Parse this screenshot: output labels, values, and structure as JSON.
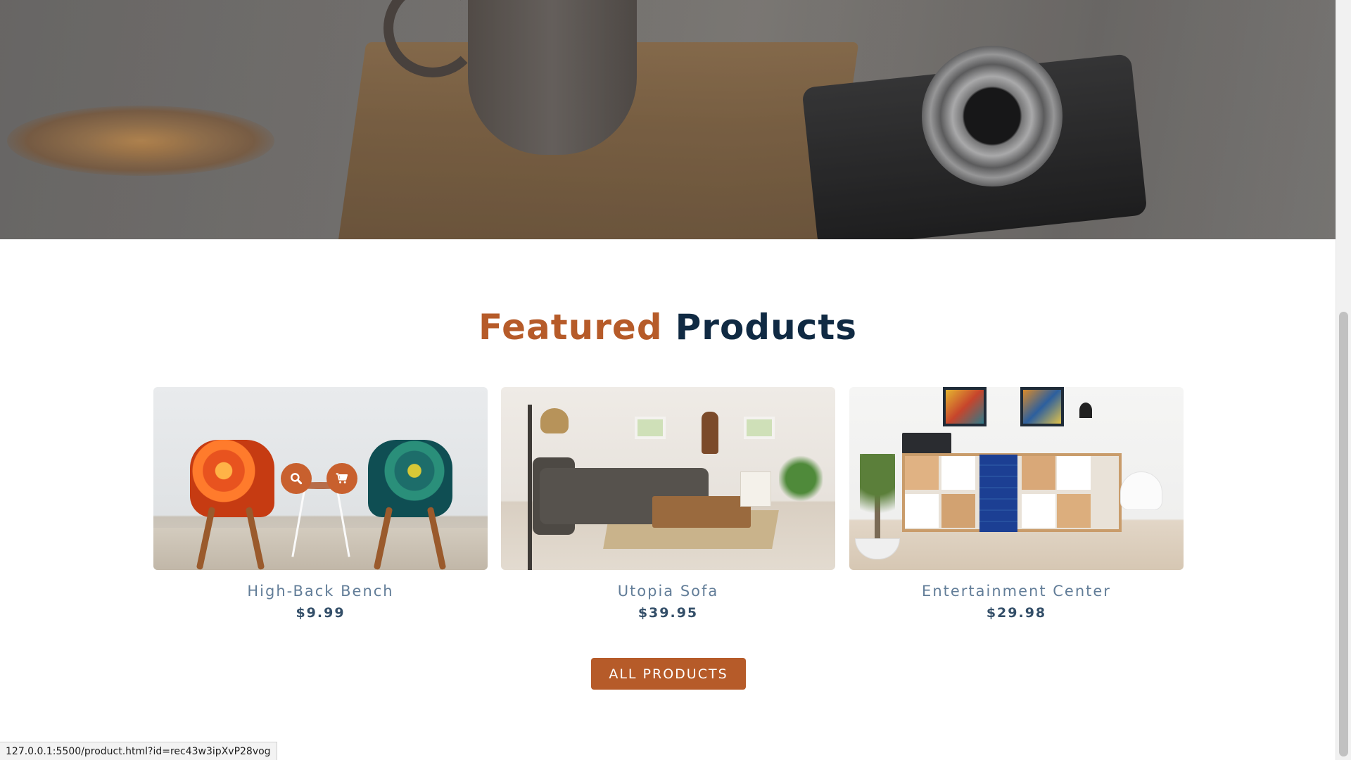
{
  "section": {
    "title_accent": "Featured",
    "title_main": "Products"
  },
  "products": [
    {
      "name": "High-Back Bench",
      "price": "$9.99"
    },
    {
      "name": "Utopia Sofa",
      "price": "$39.95"
    },
    {
      "name": "Entertainment Center",
      "price": "$29.98"
    }
  ],
  "overlay_icons": [
    "search-icon",
    "cart-icon"
  ],
  "buttons": {
    "all_products": "ALL PRODUCTS"
  },
  "status_bar": {
    "url": "127.0.0.1:5500/product.html?id=rec43w3ipXvP28vog"
  },
  "colors": {
    "accent": "#b65b29",
    "heading": "#102a43",
    "product_name": "#627d98",
    "product_price": "#334e68"
  }
}
